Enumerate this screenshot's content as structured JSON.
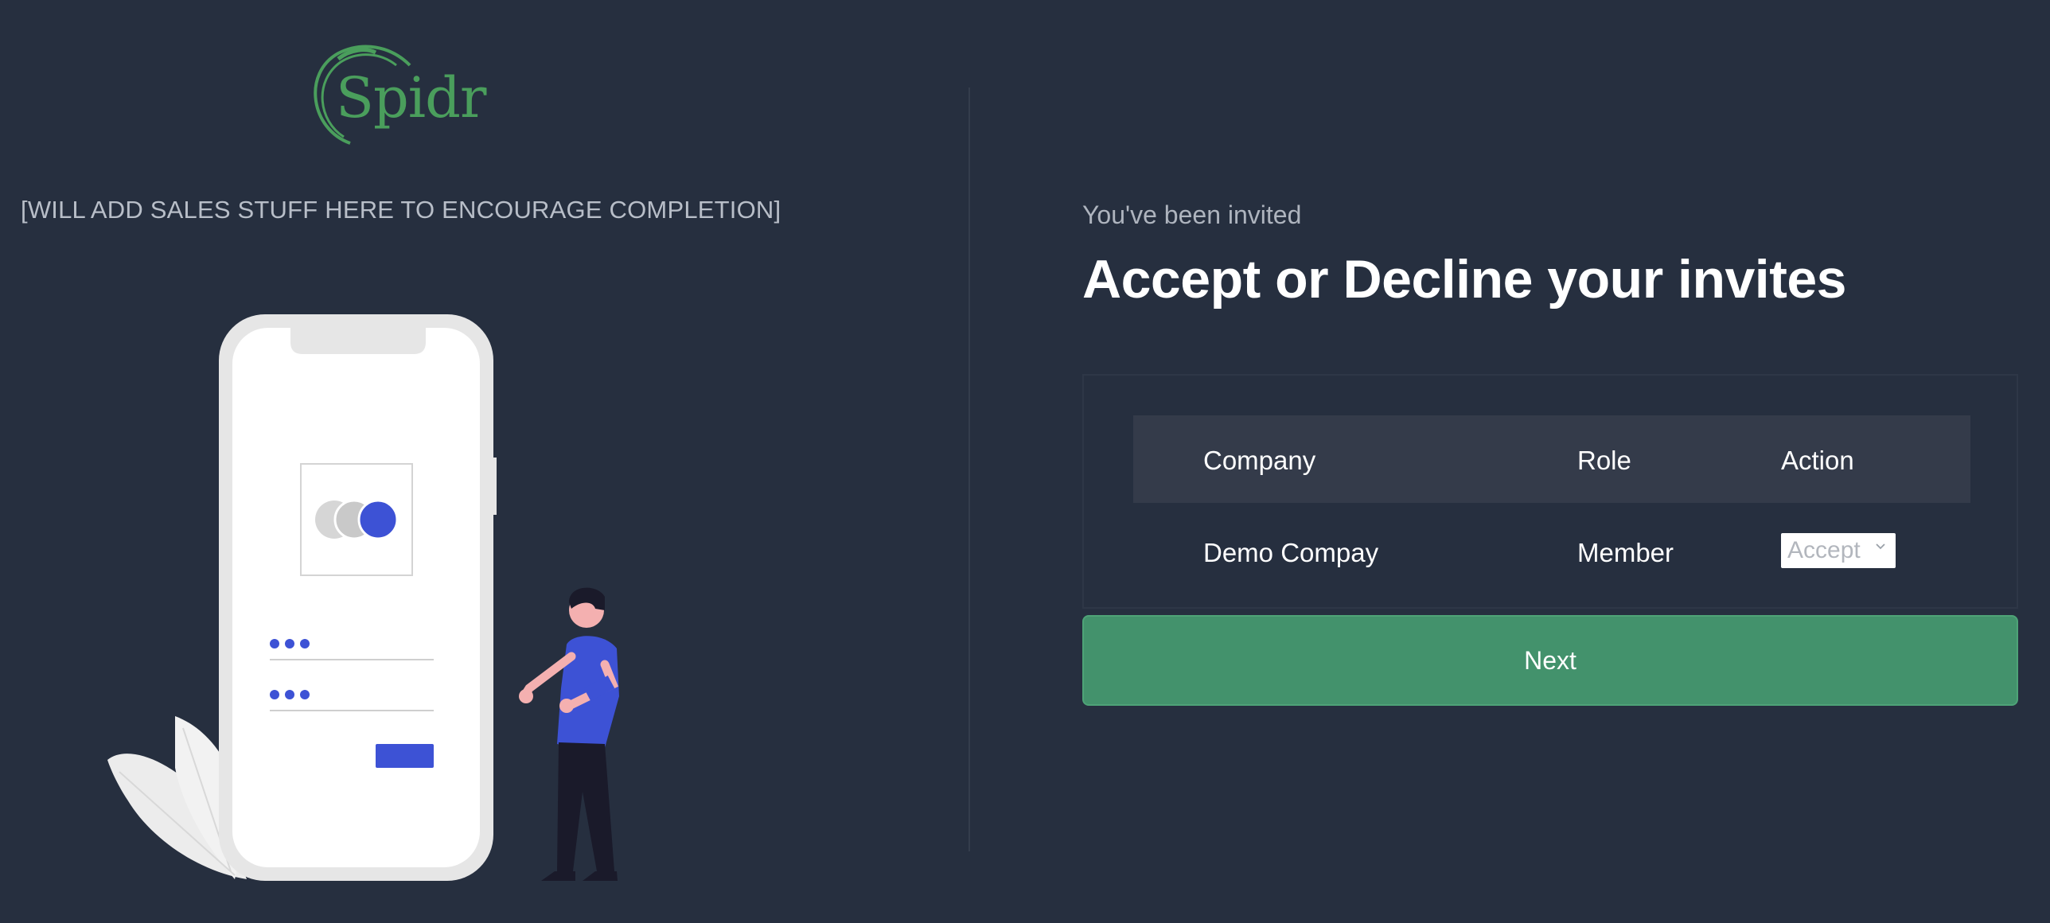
{
  "brand": {
    "logo_text": "Spidr",
    "color": "#4a9e5c"
  },
  "left": {
    "sales_text": "[WILL ADD SALES STUFF HERE TO ENCOURAGE COMPLETION]"
  },
  "invite": {
    "subtitle": "You've been invited",
    "title": "Accept or Decline your invites"
  },
  "table": {
    "headers": {
      "company": "Company",
      "role": "Role",
      "action": "Action"
    },
    "rows": [
      {
        "company": "Demo Compay",
        "role": "Member",
        "action": "Accept"
      }
    ]
  },
  "next_button": {
    "label": "Next",
    "color": "#43926c"
  },
  "colors": {
    "background": "#262f3f",
    "accent_blue": "#3d52d5"
  }
}
